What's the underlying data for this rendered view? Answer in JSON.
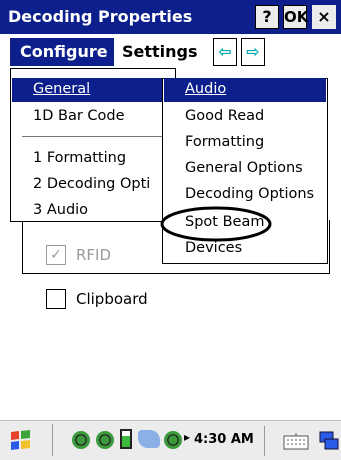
{
  "window": {
    "title": "Decoding Properties",
    "help_label": "?",
    "ok_label": "OK",
    "close_label": "×"
  },
  "menubar": {
    "configure_label": "Configure",
    "settings_label": "Settings",
    "prev_arrow": "⇦",
    "next_arrow": "⇨"
  },
  "configure_menu": {
    "items": [
      "General",
      "1D Bar Code",
      "1 Formatting",
      "2 Decoding Opti",
      "3 Audio"
    ]
  },
  "general_submenu": {
    "items": [
      "Audio",
      "Good Read",
      "Formatting",
      "General Options",
      "Decoding Options",
      "Spot Beam",
      "Devices"
    ]
  },
  "background": {
    "rfid_label": "RFID",
    "rfid_checked": true,
    "clipboard_label": "Clipboard",
    "clipboard_checked": false
  },
  "taskbar": {
    "time": "4:30 AM"
  },
  "colors": {
    "title_bg": "#0c1f8c",
    "highlight": "#0c1f8c",
    "taskbar_bg": "#ececec"
  }
}
